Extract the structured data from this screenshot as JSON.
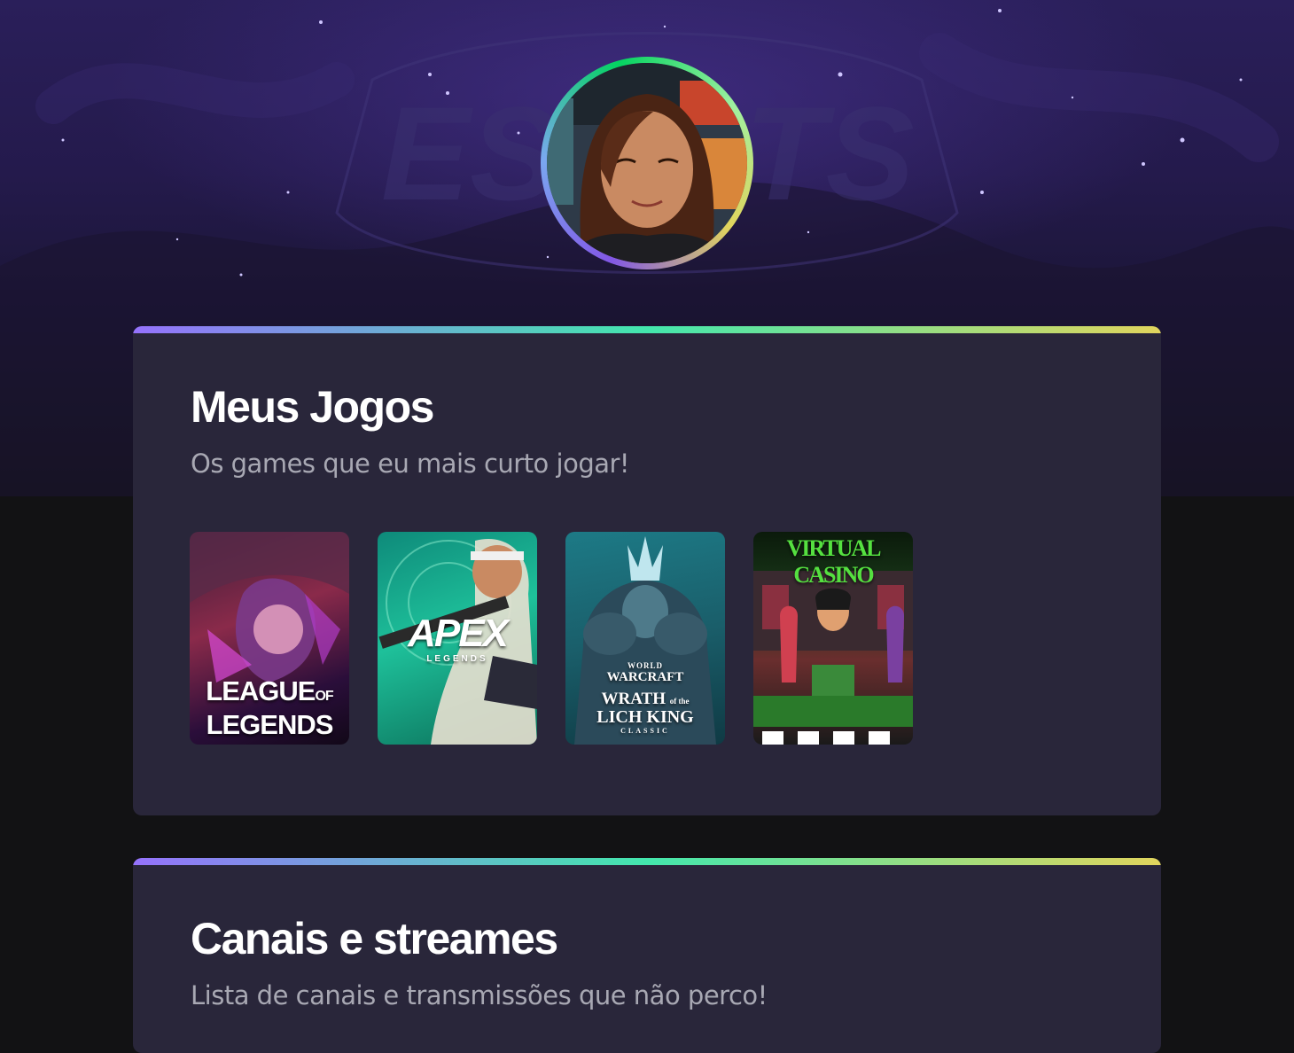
{
  "profile": {
    "avatar_alt": "Foto de perfil"
  },
  "sections": [
    {
      "title": "Meus Jogos",
      "subtitle": "Os games que eu mais curto jogar!",
      "games": [
        {
          "name": "League of Legends",
          "line1": "LEAGUE",
          "line1b": "OF",
          "line2": "LEGENDS"
        },
        {
          "name": "Apex Legends",
          "line1": "APEX",
          "line2": "LEGENDS"
        },
        {
          "name": "World of Warcraft: Wrath of the Lich King Classic",
          "line1": "WORLD",
          "line1b": "WARCRAFT",
          "line2": "WRATH",
          "line2b": "of the",
          "line3": "LICH KING",
          "line4": "CLASSIC"
        },
        {
          "name": "Virtual Casino",
          "line1": "VIRTUAL CASINO"
        }
      ]
    },
    {
      "title": "Canais e streames",
      "subtitle": "Lista de canais e transmissões que não perco!"
    }
  ],
  "colors": {
    "background": "#121214",
    "card": "#29263a",
    "accent_gradient": [
      "#9572fc",
      "#43e7ad",
      "#e1d55d"
    ],
    "title": "#ffffff",
    "subtitle": "#a8a8b3"
  }
}
